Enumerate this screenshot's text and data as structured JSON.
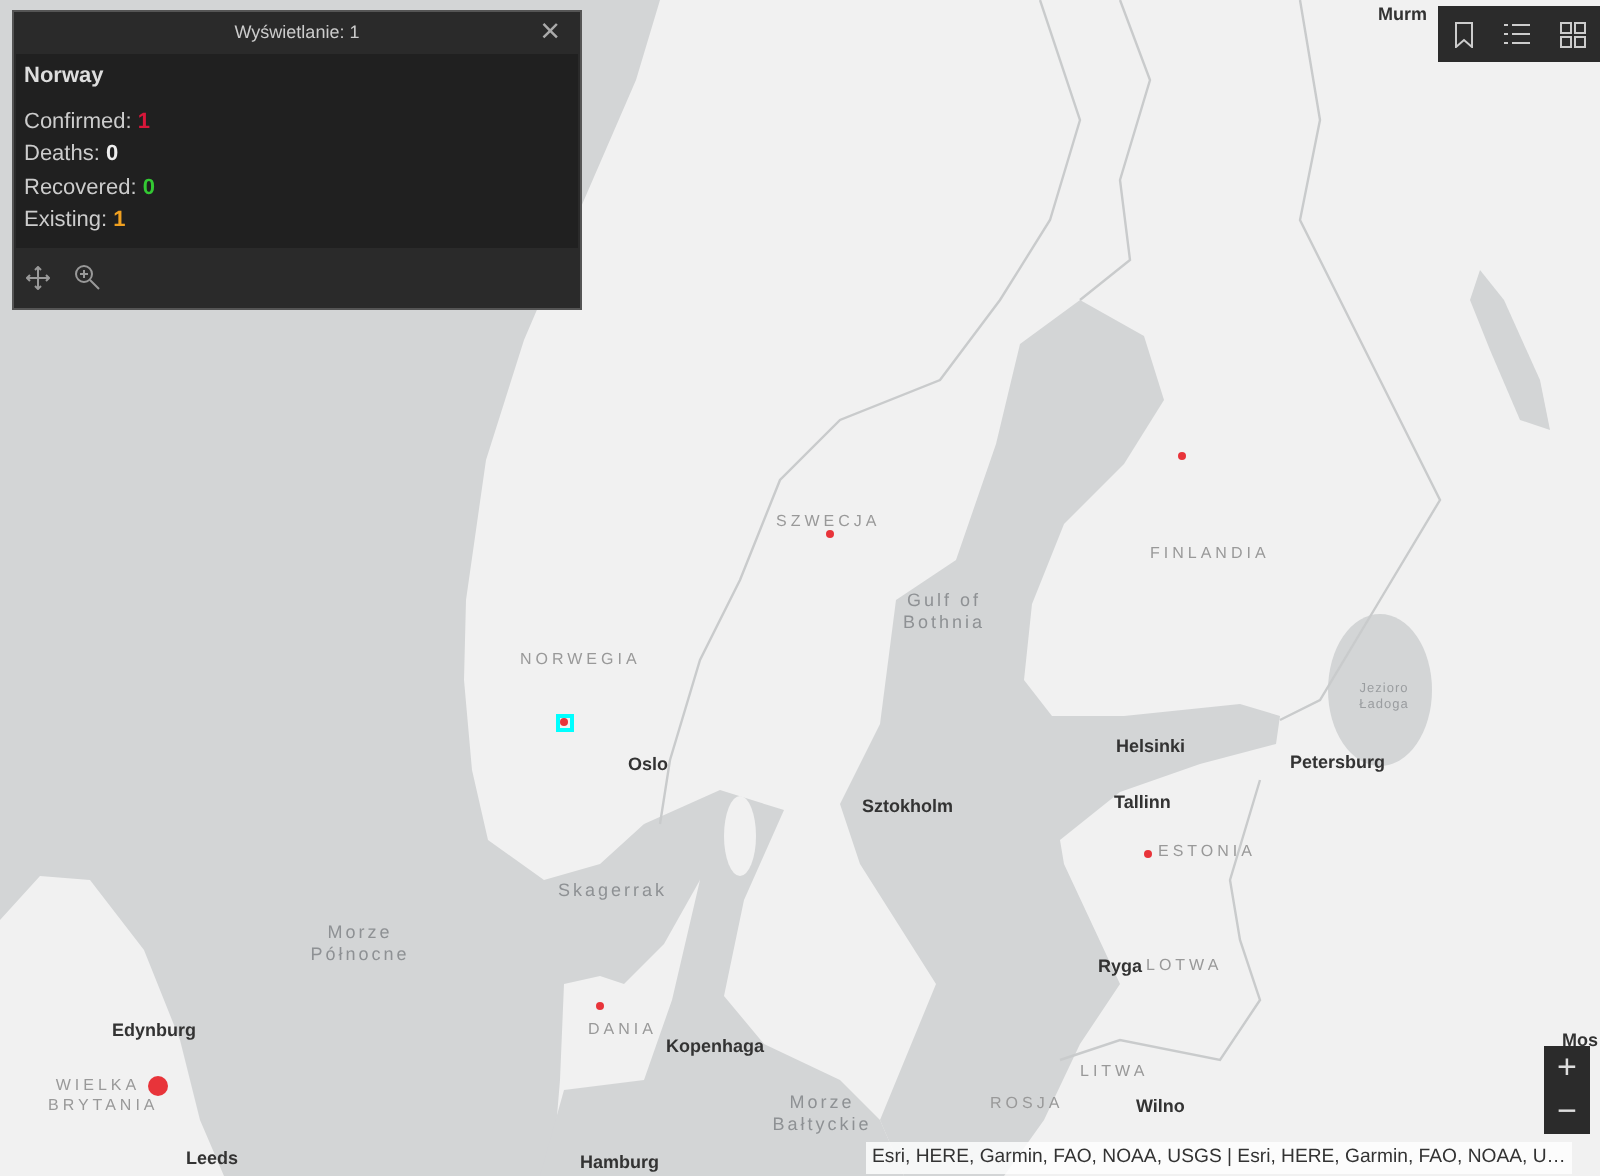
{
  "popup": {
    "title": "Wyświetlanie: 1",
    "close": "×",
    "heading": "Norway",
    "fields": [
      {
        "label": "Confirmed:",
        "value": "1",
        "color": "#d8173a"
      },
      {
        "label": "Deaths:",
        "value": "0",
        "color": "#eeeeee"
      },
      {
        "label": "Recovered:",
        "value": "0",
        "color": "#33c933"
      },
      {
        "label": "Existing:",
        "value": "1",
        "color": "#f0a020"
      }
    ]
  },
  "map": {
    "labels": [
      {
        "text": "Murm",
        "kind": "city"
      },
      {
        "text": "SZWECJA",
        "kind": "country"
      },
      {
        "text": "FINLANDIA",
        "kind": "country"
      },
      {
        "text": "Gulf of Bothnia",
        "kind": "water"
      },
      {
        "text": "NORWEGIA",
        "kind": "country"
      },
      {
        "text": "Jezioro Ładoga",
        "kind": "lake"
      },
      {
        "text": "Oslo",
        "kind": "city"
      },
      {
        "text": "Helsinki",
        "kind": "city"
      },
      {
        "text": "Petersburg",
        "kind": "city"
      },
      {
        "text": "Tallinn",
        "kind": "city"
      },
      {
        "text": "Sztokholm",
        "kind": "city"
      },
      {
        "text": "ESTONIA",
        "kind": "country"
      },
      {
        "text": "Skagerrak",
        "kind": "water"
      },
      {
        "text": "Morze Północne",
        "kind": "water"
      },
      {
        "text": "Ryga",
        "kind": "city"
      },
      {
        "text": "LOTWA",
        "kind": "country"
      },
      {
        "text": "Edynburg",
        "kind": "city"
      },
      {
        "text": "DANIA",
        "kind": "country"
      },
      {
        "text": "Kopenhaga",
        "kind": "city"
      },
      {
        "text": "WIELKA BRYTANIA",
        "kind": "country"
      },
      {
        "text": "Morze Bałtyckie",
        "kind": "water"
      },
      {
        "text": "LITWA",
        "kind": "country"
      },
      {
        "text": "ROSJA",
        "kind": "country"
      },
      {
        "text": "Wilno",
        "kind": "city"
      },
      {
        "text": "Leeds",
        "kind": "city"
      },
      {
        "text": "Hamburg",
        "kind": "city"
      },
      {
        "text": "Mos",
        "kind": "city"
      }
    ],
    "points": [
      {
        "kind": "small",
        "selected": true
      },
      {
        "kind": "small",
        "selected": false
      },
      {
        "kind": "small",
        "selected": false
      },
      {
        "kind": "small",
        "selected": false
      },
      {
        "kind": "small",
        "selected": false
      },
      {
        "kind": "large",
        "selected": false
      }
    ]
  },
  "attribution": "Esri, HERE, Garmin, FAO, NOAA, USGS | Esri, HERE, Garmin, FAO, NOAA, U…",
  "zoom": {
    "in": "+",
    "out": "−"
  }
}
